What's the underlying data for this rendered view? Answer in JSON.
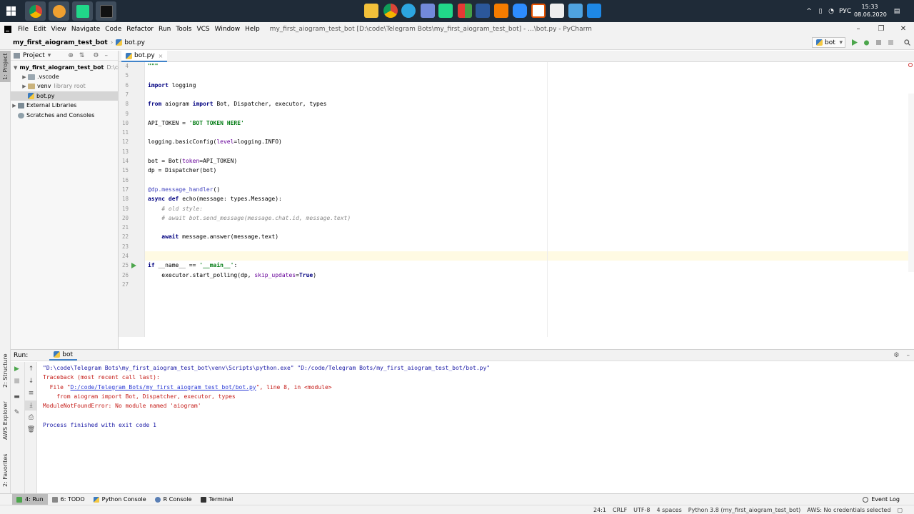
{
  "taskbar": {
    "time": "15:33",
    "date": "08.06.2020",
    "lang": "РУС"
  },
  "menubar": {
    "items": [
      "File",
      "Edit",
      "View",
      "Navigate",
      "Code",
      "Refactor",
      "Run",
      "Tools",
      "VCS",
      "Window",
      "Help"
    ],
    "window_title": "my_first_aiogram_test_bot [D:\\code\\Telegram Bots\\my_first_aiogram_test_bot] - ...\\bot.py - PyCharm"
  },
  "navbar": {
    "project": "my_first_aiogram_test_bot",
    "file": "bot.py",
    "run_config": "bot"
  },
  "left_strip": {
    "project_tab": "1: Project",
    "structure_tab": "2: Structure",
    "aws_tab": "AWS Explorer",
    "favorites_tab": "2: Favorites"
  },
  "project_panel": {
    "title": "Project",
    "tree": [
      {
        "label": "my_first_aiogram_test_bot",
        "hint": "D:\\cod",
        "level": 0,
        "expanded": true
      },
      {
        "label": ".vscode",
        "hint": "",
        "level": 1,
        "expanded": false
      },
      {
        "label": "venv",
        "hint": "library root",
        "level": 1,
        "expanded": false
      },
      {
        "label": "bot.py",
        "hint": "",
        "level": 1,
        "selected": true
      },
      {
        "label": "External Libraries",
        "hint": "",
        "level": 0,
        "expanded": false
      },
      {
        "label": "Scratches and Consoles",
        "hint": "",
        "level": 0
      }
    ]
  },
  "editor": {
    "tab": "bot.py",
    "lines": [
      {
        "n": "4",
        "text": "\"\"\""
      },
      {
        "n": "5",
        "text": ""
      },
      {
        "n": "6",
        "text": "import logging"
      },
      {
        "n": "7",
        "text": ""
      },
      {
        "n": "8",
        "text": "from aiogram import Bot, Dispatcher, executor, types"
      },
      {
        "n": "9",
        "text": ""
      },
      {
        "n": "10",
        "text": "API_TOKEN = 'BOT TOKEN HERE'"
      },
      {
        "n": "11",
        "text": ""
      },
      {
        "n": "12",
        "text": "logging.basicConfig(level=logging.INFO)"
      },
      {
        "n": "13",
        "text": ""
      },
      {
        "n": "14",
        "text": "bot = Bot(token=API_TOKEN)"
      },
      {
        "n": "15",
        "text": "dp = Dispatcher(bot)"
      },
      {
        "n": "16",
        "text": ""
      },
      {
        "n": "17",
        "text": "@dp.message_handler()"
      },
      {
        "n": "18",
        "text": "async def echo(message: types.Message):"
      },
      {
        "n": "19",
        "text": "    # old style:"
      },
      {
        "n": "20",
        "text": "    # await bot.send_message(message.chat.id, message.text)"
      },
      {
        "n": "21",
        "text": ""
      },
      {
        "n": "22",
        "text": "    await message.answer(message.text)"
      },
      {
        "n": "23",
        "text": ""
      },
      {
        "n": "24",
        "text": ""
      },
      {
        "n": "25",
        "text": "if __name__ == '__main__':"
      },
      {
        "n": "26",
        "text": "    executor.start_polling(dp, skip_updates=True)"
      },
      {
        "n": "27",
        "text": ""
      }
    ]
  },
  "run_panel": {
    "label": "Run:",
    "tab": "bot",
    "output": [
      {
        "kind": "cmd",
        "text": "\"D:\\code\\Telegram Bots\\my_first_aiogram_test_bot\\venv\\Scripts\\python.exe\" \"D:/code/Telegram Bots/my_first_aiogram_test_bot/bot.py\""
      },
      {
        "kind": "err",
        "text": "Traceback (most recent call last):"
      },
      {
        "kind": "err_file",
        "prefix": "  File \"",
        "link": "D:/code/Telegram Bots/my_first_aiogram_test_bot/bot.py",
        "suffix": "\", line 8, in <module>"
      },
      {
        "kind": "err",
        "text": "    from aiogram import Bot, Dispatcher, executor, types"
      },
      {
        "kind": "err",
        "text": "ModuleNotFoundError: No module named 'aiogram'"
      },
      {
        "kind": "blank",
        "text": ""
      },
      {
        "kind": "cmd",
        "text": "Process finished with exit code 1"
      }
    ]
  },
  "bottom_tools": {
    "run": "4: Run",
    "todo": "6: TODO",
    "python_console": "Python Console",
    "r_console": "R Console",
    "terminal": "Terminal",
    "event_log": "Event Log"
  },
  "statusbar": {
    "position": "24:1",
    "line_sep": "CRLF",
    "encoding": "UTF-8",
    "indent": "4 spaces",
    "interpreter": "Python 3.8 (my_first_aiogram_test_bot)",
    "aws": "AWS: No credentials selected"
  }
}
